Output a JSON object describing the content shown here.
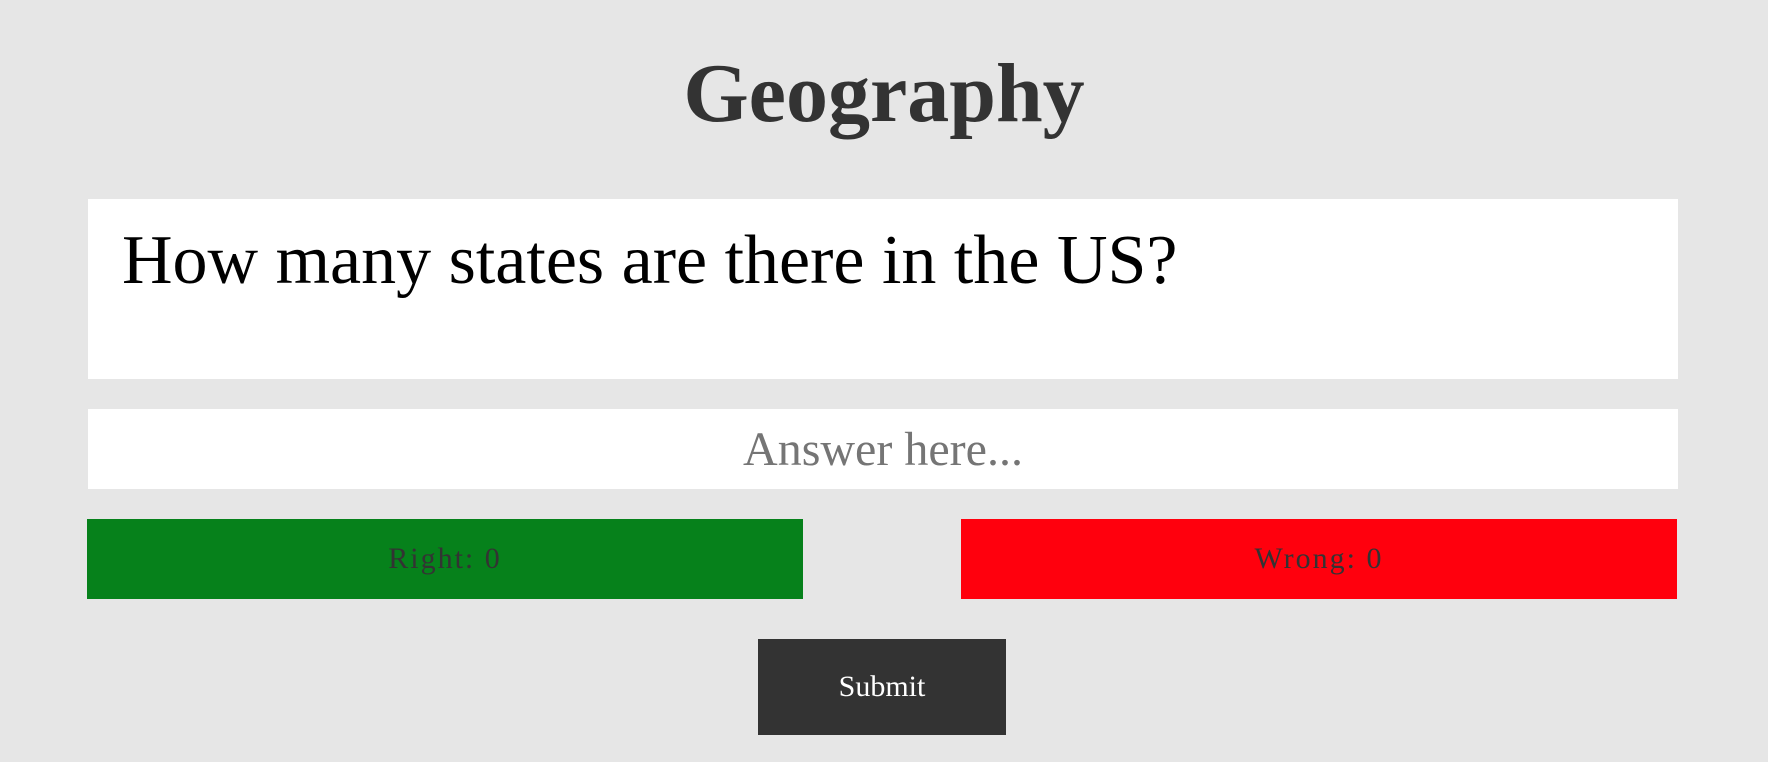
{
  "page": {
    "title": "Geography"
  },
  "question": {
    "text": "How many states are there in the US?"
  },
  "answer": {
    "value": "",
    "placeholder": "Answer here..."
  },
  "score": {
    "right_label": "Right: 0",
    "wrong_label": "Wrong: 0",
    "right_color": "#06811b",
    "wrong_color": "#ff000d"
  },
  "actions": {
    "submit_label": "Submit",
    "submit_color": "#333333"
  },
  "theme": {
    "background": "#e6e6e6",
    "title_color": "#333333"
  }
}
